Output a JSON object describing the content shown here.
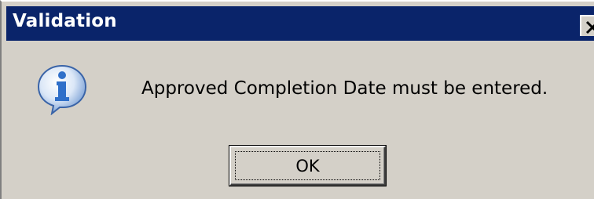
{
  "window": {
    "title": "Validation"
  },
  "dialog": {
    "icon": "information-icon",
    "message": "Approved Completion Date must be entered.",
    "ok_label": "OK"
  },
  "colors": {
    "titlebar": "#0a246a",
    "title_text": "#ffffff",
    "dialog_background": "#d4d0c8",
    "icon_blue": "#2f6fc9"
  }
}
